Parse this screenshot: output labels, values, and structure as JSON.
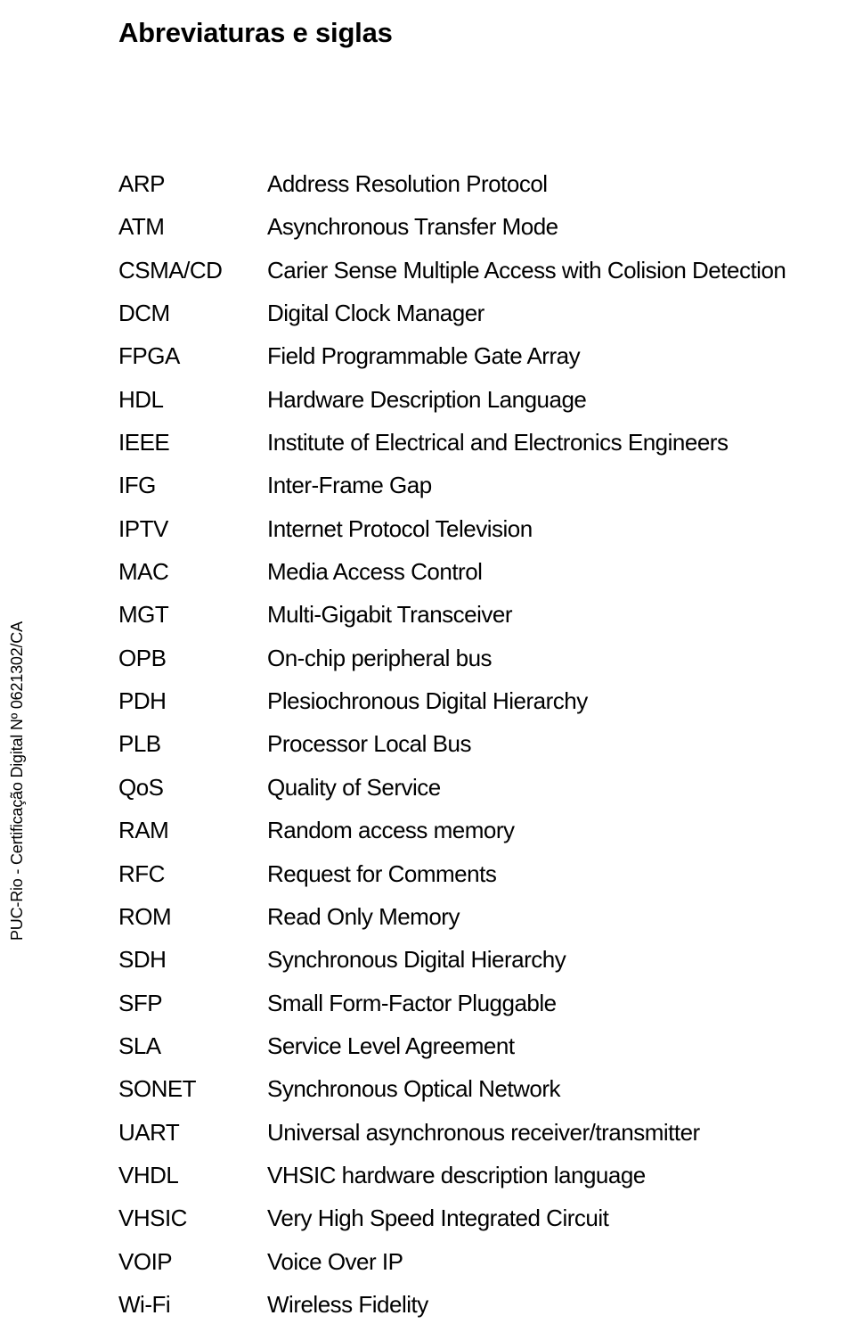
{
  "document": {
    "title": "Abreviaturas e siglas",
    "side_stamp": "PUC-Rio - Certificação Digital Nº 0621302/CA",
    "abbreviations": [
      {
        "term": "ARP",
        "definition": "Address Resolution Protocol"
      },
      {
        "term": "ATM",
        "definition": "Asynchronous Transfer Mode"
      },
      {
        "term": "CSMA/CD",
        "definition": "Carier Sense Multiple Access with Colision Detection"
      },
      {
        "term": "DCM",
        "definition": "Digital Clock Manager"
      },
      {
        "term": "FPGA",
        "definition": "Field Programmable Gate Array"
      },
      {
        "term": "HDL",
        "definition": "Hardware Description Language"
      },
      {
        "term": "IEEE",
        "definition": "Institute of Electrical and Electronics Engineers"
      },
      {
        "term": "IFG",
        "definition": "Inter-Frame Gap"
      },
      {
        "term": "IPTV",
        "definition": "Internet Protocol Television"
      },
      {
        "term": "MAC",
        "definition": "Media Access Control"
      },
      {
        "term": "MGT",
        "definition": "Multi-Gigabit Transceiver"
      },
      {
        "term": "OPB",
        "definition": "On-chip peripheral bus"
      },
      {
        "term": "PDH",
        "definition": "Plesiochronous Digital Hierarchy"
      },
      {
        "term": "PLB",
        "definition": "Processor Local Bus"
      },
      {
        "term": "QoS",
        "definition": "Quality of Service"
      },
      {
        "term": "RAM",
        "definition": "Random access memory"
      },
      {
        "term": "RFC",
        "definition": "Request for Comments"
      },
      {
        "term": "ROM",
        "definition": "Read Only Memory"
      },
      {
        "term": "SDH",
        "definition": "Synchronous Digital Hierarchy"
      },
      {
        "term": "SFP",
        "definition": "Small Form-Factor Pluggable"
      },
      {
        "term": "SLA",
        "definition": "Service Level Agreement"
      },
      {
        "term": "SONET",
        "definition": "Synchronous Optical Network"
      },
      {
        "term": "UART",
        "definition": "Universal asynchronous receiver/transmitter"
      },
      {
        "term": "VHDL",
        "definition": "VHSIC hardware description language"
      },
      {
        "term": "VHSIC",
        "definition": "Very High Speed Integrated Circuit"
      },
      {
        "term": "VOIP",
        "definition": "Voice Over IP"
      },
      {
        "term": "Wi-Fi",
        "definition": "Wireless Fidelity"
      }
    ]
  }
}
